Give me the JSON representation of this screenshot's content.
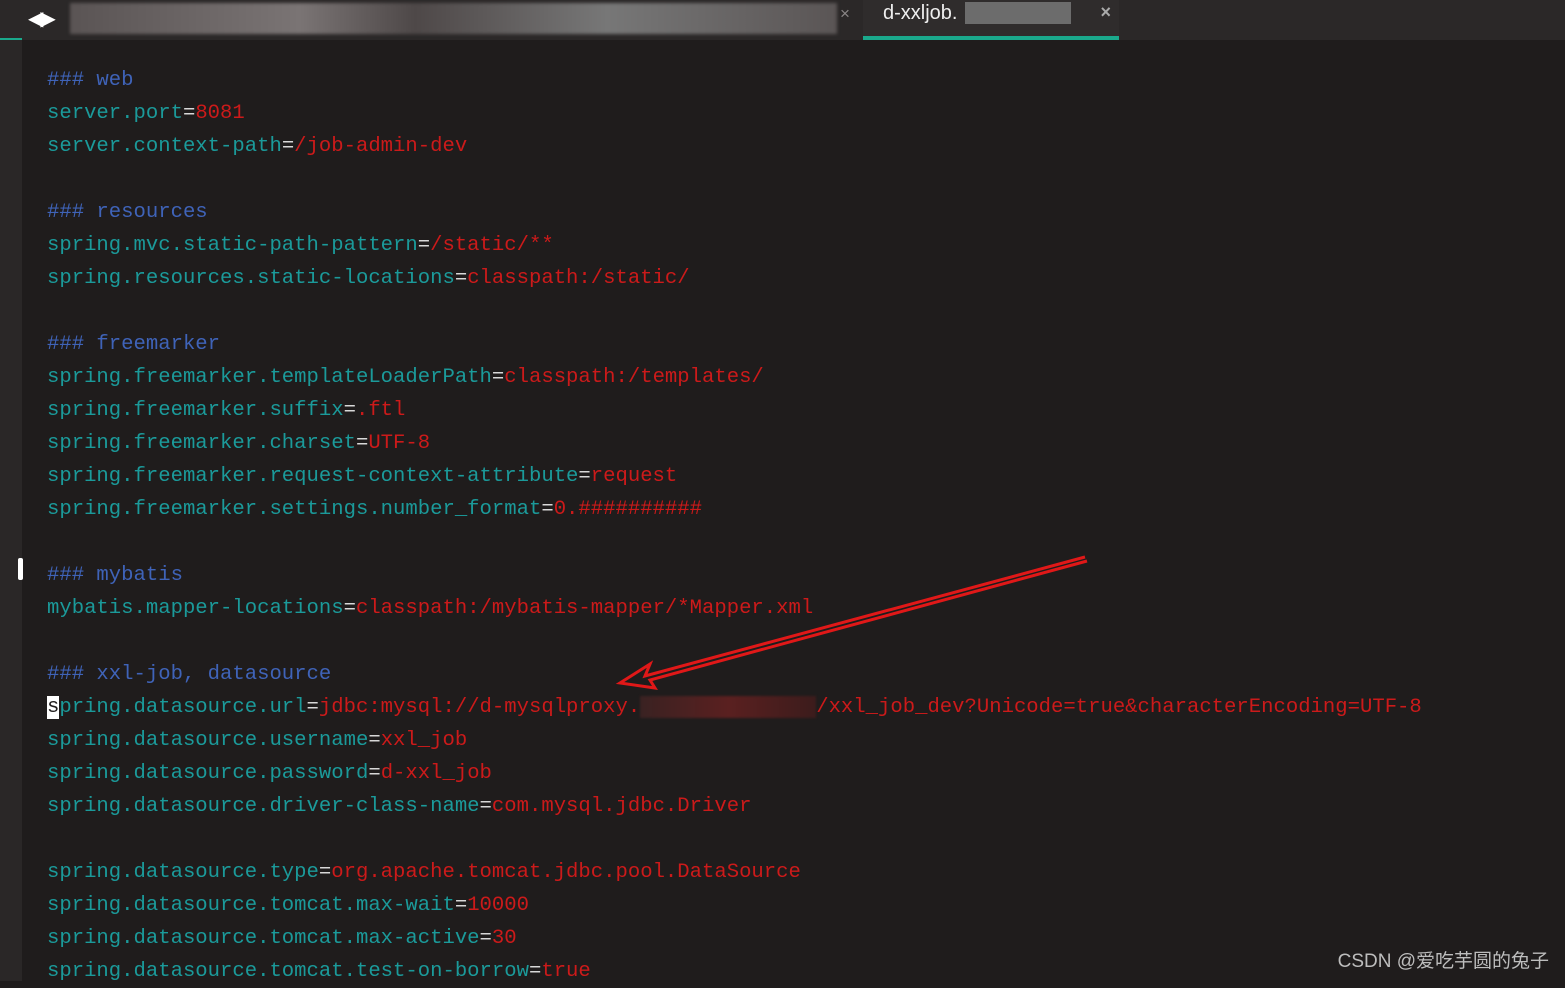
{
  "tabs": {
    "active_tab_label": "d-xxljob.",
    "close_glyph": "×",
    "nav_glyph": "◀▶"
  },
  "lines": [
    {
      "c": "### web"
    },
    {
      "k": "server.port",
      "v": "8081"
    },
    {
      "k": "server.context-path",
      "v": "/job-admin-dev"
    },
    {},
    {
      "c": "### resources"
    },
    {
      "k": "spring.mvc.static-path-pattern",
      "v": "/static/**"
    },
    {
      "k": "spring.resources.static-locations",
      "v": "classpath:/static/"
    },
    {},
    {
      "c": "### freemarker"
    },
    {
      "k": "spring.freemarker.templateLoaderPath",
      "v": "classpath:/templates/"
    },
    {
      "k": "spring.freemarker.suffix",
      "v": ".ftl"
    },
    {
      "k": "spring.freemarker.charset",
      "v": "UTF-8"
    },
    {
      "k": "spring.freemarker.request-context-attribute",
      "v": "request"
    },
    {
      "k": "spring.freemarker.settings.number_format",
      "v": "0.##########"
    },
    {},
    {
      "c": "### mybatis"
    },
    {
      "k": "mybatis.mapper-locations",
      "v": "classpath:/mybatis-mapper/*Mapper.xml"
    },
    {},
    {
      "c": "### xxl-job, datasource"
    },
    {
      "k": "spring.datasource.url",
      "v": "jdbc:mysql://d-mysqlproxy.",
      "v2": "/xxl_job_dev?Unicode=true&characterEncoding=UTF-8",
      "caret": true
    },
    {
      "k": "spring.datasource.username",
      "v": "xxl_job"
    },
    {
      "k": "spring.datasource.password",
      "v": "d-xxl_job"
    },
    {
      "k": "spring.datasource.driver-class-name",
      "v": "com.mysql.jdbc.Driver"
    },
    {},
    {
      "k": "spring.datasource.type",
      "v": "org.apache.tomcat.jdbc.pool.DataSource"
    },
    {
      "k": "spring.datasource.tomcat.max-wait",
      "v": "10000"
    },
    {
      "k": "spring.datasource.tomcat.max-active",
      "v": "30"
    },
    {
      "k": "spring.datasource.tomcat.test-on-borrow",
      "v": "true"
    }
  ],
  "watermark": "CSDN @爱吃芋圆的兔子",
  "colors": {
    "comment": "#3f63b8",
    "key": "#1b9a9a",
    "value": "#cc1a1a",
    "accent": "#1aa98c",
    "arrow": "#e01818"
  }
}
